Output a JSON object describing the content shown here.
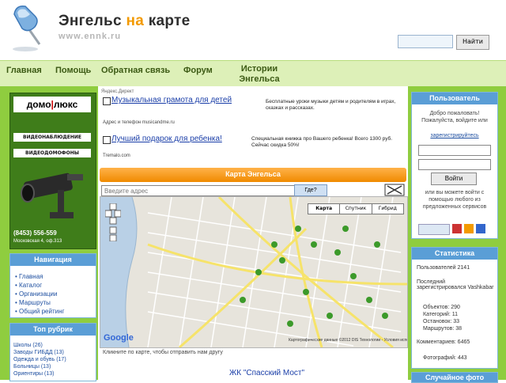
{
  "header": {
    "title_part1": "Энгельс ",
    "title_part2": "на",
    "title_part3": " карте",
    "url": "www.ennk.ru",
    "search_button": "Найти"
  },
  "nav": [
    "Главная",
    "Помощь",
    "Обратная связь",
    "Форум",
    "Истории Энгельса"
  ],
  "ad": {
    "brand_a": "домо",
    "brand_sep": "|",
    "brand_b": "люкс",
    "line1": "ВИДЕОНАБЛЮДЕНИЕ",
    "line2": "ВИДЕОДОМОФОНЫ",
    "phone": "(8453)   556-559",
    "address": "Московская 4, оф.313"
  },
  "navigation_box": {
    "title": "Навигация",
    "items": [
      "Главная",
      "Каталог",
      "Организации",
      "Маршруты",
      "Общий рейтинг"
    ]
  },
  "top_rubrics_box": {
    "title": "Топ рубрик",
    "items": [
      "Школы (26)",
      "Заводы ГИБДД (13)",
      "Одежда и обувь (17)",
      "Больницы (13)",
      "Ориентиры (13)"
    ]
  },
  "ads_block": {
    "label": "Яндекс.Директ",
    "ad1_title": "Музыкальная грамота для детей",
    "ad1_text": "Бесплатные уроки музыки детям и родителям в играх, сказках и рассказах.",
    "ad1_meta": "Адрес и телефон  musicandme.ru",
    "ad2_title": "Лучший подарок для ребенка!",
    "ad2_text": "Специальная книжка про Вашего ребенка! Всего 1300 руб. Сейчас скидка 50%!",
    "ad2_meta": "Tremalo.com"
  },
  "map": {
    "header": "Карта Энгельса",
    "address_placeholder": "Введите адрес",
    "find_button": "Где?",
    "types": [
      "Карта",
      "Спутник",
      "Гибрид"
    ],
    "copyright": "Картографические данные ©2012 DIS Технологии - Условия использования",
    "caption": "Кликните по карте, чтобы отправить нам другу",
    "logo": "Google"
  },
  "featured_title": "ЖК \"Спасский Мост\"",
  "user_box": {
    "title": "Пользователь",
    "text": "Добро пожаловать! Пожалуйста, войдите или",
    "register_link": "зарегистрируйтесь",
    "login_button": "Войти",
    "note": "или вы можете войти с помощью любого из предложенных сервисов"
  },
  "stats_box": {
    "title": "Статистика",
    "items": [
      "Пользователей 2141",
      "Последний зарегистрировался Vashkabar",
      "Объектов: 290",
      "Категорий: 11",
      "Остановок: 33",
      "Маршрутов: 38",
      "Комментариев: 6465",
      "Фотографий: 443"
    ]
  },
  "bottom_right_title": "Случайное фото",
  "colors": {
    "accent": "#f39a00",
    "green": "#8fcd3f",
    "blue_header": "#5a9ed6",
    "link": "#1e4fa0"
  }
}
